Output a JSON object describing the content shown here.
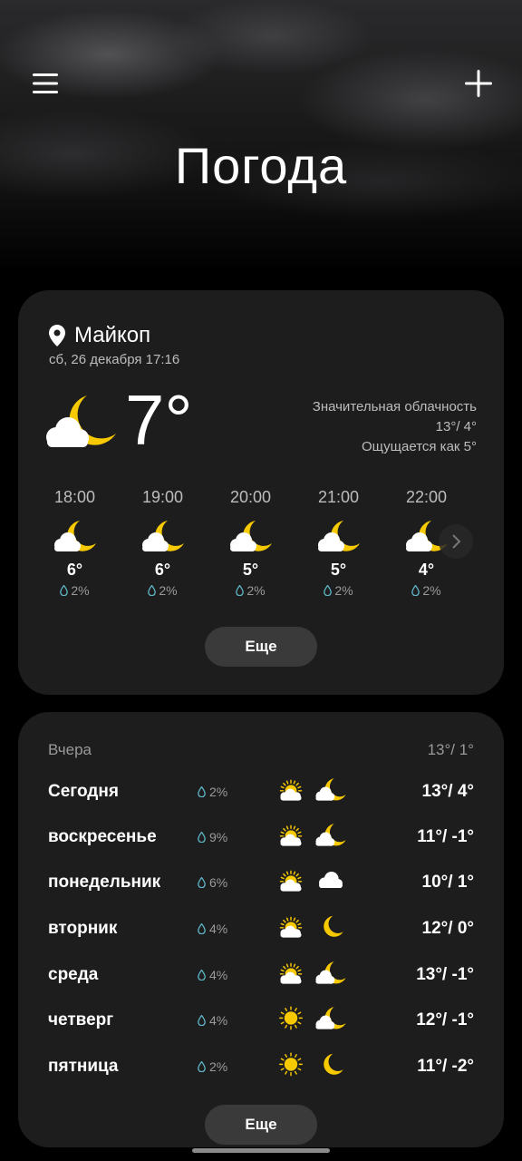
{
  "app": {
    "title": "Погода"
  },
  "current": {
    "city": "Майкоп",
    "datetime": "сб, 26 декабря 17:16",
    "temp": "7°",
    "condition": "Значительная облачность",
    "high_low": "13°/ 4°",
    "feels_like": "Ощущается как 5°",
    "icon": "moon-cloud-icon"
  },
  "hourly": [
    {
      "time": "18:00",
      "temp": "6°",
      "precip": "2%",
      "icon": "moon-cloud-icon"
    },
    {
      "time": "19:00",
      "temp": "6°",
      "precip": "2%",
      "icon": "moon-cloud-icon"
    },
    {
      "time": "20:00",
      "temp": "5°",
      "precip": "2%",
      "icon": "moon-cloud-icon"
    },
    {
      "time": "21:00",
      "temp": "5°",
      "precip": "2%",
      "icon": "moon-cloud-icon"
    },
    {
      "time": "22:00",
      "temp": "4°",
      "precip": "2%",
      "icon": "moon-cloud-icon"
    }
  ],
  "more_label": "Еще",
  "yesterday": {
    "label": "Вчера",
    "temps": "13°/ 1°"
  },
  "daily": [
    {
      "day": "Сегодня",
      "precip": "2%",
      "day_icon": "sun-cloud-icon",
      "night_icon": "moon-cloud-icon",
      "temps": "13°/ 4°"
    },
    {
      "day": "воскресенье",
      "precip": "9%",
      "day_icon": "sun-cloud-icon",
      "night_icon": "moon-cloud-icon",
      "temps": "11°/ -1°"
    },
    {
      "day": "понедельник",
      "precip": "6%",
      "day_icon": "sun-cloud-icon",
      "night_icon": "cloud-icon",
      "temps": "10°/ 1°"
    },
    {
      "day": "вторник",
      "precip": "4%",
      "day_icon": "sun-cloud-icon",
      "night_icon": "moon-icon",
      "temps": "12°/ 0°"
    },
    {
      "day": "среда",
      "precip": "4%",
      "day_icon": "sun-cloud-icon",
      "night_icon": "moon-cloud-icon",
      "temps": "13°/ -1°"
    },
    {
      "day": "четверг",
      "precip": "4%",
      "day_icon": "sun-icon",
      "night_icon": "moon-cloud-icon",
      "temps": "12°/ -1°"
    },
    {
      "day": "пятница",
      "precip": "2%",
      "day_icon": "sun-icon",
      "night_icon": "moon-icon",
      "temps": "11°/ -2°"
    }
  ],
  "colors": {
    "card": "#1d1d1d",
    "accent_yellow": "#f7c900",
    "button": "#3a3a3a"
  }
}
